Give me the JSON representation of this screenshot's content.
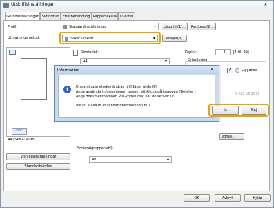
{
  "window": {
    "title": "Utskriftsinställningar",
    "close_glyph": "✕"
  },
  "tabs": [
    {
      "label": "Grundinställningar"
    },
    {
      "label": "Sidformat"
    },
    {
      "label": "Efterbehandling"
    },
    {
      "label": "Pappersskälla"
    },
    {
      "label": "Kvalitet"
    }
  ],
  "profile": {
    "label": "Profil:",
    "value": "Standardinställningar",
    "add_button": "Lägg till(1)...",
    "edit_button": "Redigera(2)..."
  },
  "output_method": {
    "label": "Utmatningsmetod:",
    "value": "Säker utskrift",
    "details_button": "Detaljer(3)..."
  },
  "page_size": {
    "label": "Sidstorlek:",
    "value": "A4"
  },
  "copies": {
    "label": "Kopior:",
    "value": "1",
    "range": "[1 till 99]"
  },
  "orientation": {
    "label": "Orientering",
    "landscape_label": "Liggande",
    "landscape_glyph": "A"
  },
  "scale_partial": "% [25 till 200]",
  "preview": {
    "caption": "A4 [Skala: Auto]"
  },
  "left_buttons": {
    "view_settings": "Visningsinställningar",
    "defaults": "Standardvärden"
  },
  "collate": {
    "label": "Sortera/gruppera(H):",
    "value": "Av"
  },
  "bottom_buttons": {
    "ok": "OK",
    "cancel": "Avbryt",
    "help": "Hjälp"
  },
  "partial_right_button": "egmal...",
  "dialog": {
    "title": "Information",
    "close_glyph": "✕",
    "icon_glyph": "i",
    "message_line1": "Utmatningsmetoden ändras till [Säker utskrift].",
    "message_line2": "Ange användarinformationen genom att klicka på knappen [Detaljer].",
    "message_line3": "Ange dokumentnamnet, PIN-koden osv. när du skriver ut.",
    "question": "Vill du ställa in användarinformationen nu?",
    "yes_button": "Ja",
    "no_button": "Nej"
  },
  "colors": {
    "highlight": "#f0a000",
    "dialog_frame": "#c9d9ee",
    "info_icon": "#2a62c8"
  }
}
